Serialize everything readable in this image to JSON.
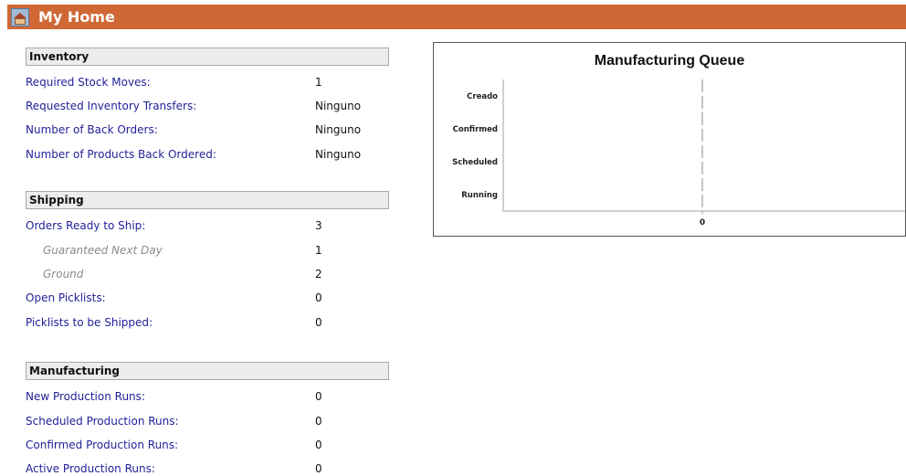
{
  "header": {
    "title": "My Home",
    "icon": "home-picture-icon",
    "color": "#cf6835"
  },
  "inventory": {
    "title": "Inventory",
    "rows": [
      {
        "label": "Required Stock Moves:",
        "value": "1"
      },
      {
        "label": "Requested Inventory Transfers:",
        "value": "Ninguno"
      },
      {
        "label": "Number of Back Orders:",
        "value": "Ninguno"
      },
      {
        "label": "Number of Products Back Ordered:",
        "value": "Ninguno"
      }
    ]
  },
  "shipping": {
    "title": "Shipping",
    "rows": [
      {
        "label": "Orders Ready to Ship:",
        "value": "3"
      },
      {
        "label": "Guaranteed Next Day",
        "value": "1"
      },
      {
        "label": "Ground",
        "value": "2"
      },
      {
        "label": "Open Picklists:",
        "value": "0"
      },
      {
        "label": "Picklists to be Shipped:",
        "value": "0"
      }
    ]
  },
  "manufacturing": {
    "title": "Manufacturing",
    "rows": [
      {
        "label": "New Production Runs:",
        "value": "0"
      },
      {
        "label": "Scheduled Production Runs:",
        "value": "0"
      },
      {
        "label": "Confirmed Production Runs:",
        "value": "0"
      },
      {
        "label": "Active Production Runs:",
        "value": "0"
      }
    ]
  },
  "chart_data": {
    "type": "bar",
    "orientation": "horizontal",
    "title": "Manufacturing Queue",
    "categories": [
      "Creado",
      "Confirmed",
      "Scheduled",
      "Running"
    ],
    "values": [
      0,
      0,
      0,
      0
    ],
    "x_ticks": [
      "0"
    ],
    "xlabel": "",
    "ylabel": "",
    "grid": false
  }
}
